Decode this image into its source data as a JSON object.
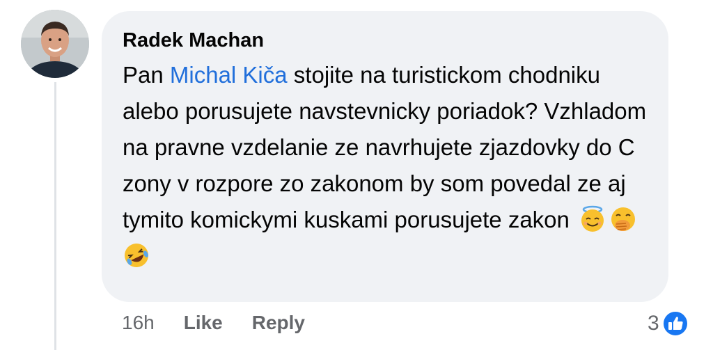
{
  "comment": {
    "author": "Radek Machan",
    "text_before": "Pan ",
    "mention": "Michal Kiča",
    "text_after": " stojite na turistickom chodniku alebo porusujete navstevnicky poriadok? Vzhladom na pravne vzdelanie ze navrhujete zjazdovky do C zony v rozpore zo zakonom by som povedal ze aj tymito komickymi kuskami porusujete zakon ",
    "emojis": [
      "smiling-face-with-halo-icon",
      "face-with-hand-over-mouth-icon",
      "rolling-on-floor-laughing-icon"
    ]
  },
  "actions": {
    "time": "16h",
    "like_label": "Like",
    "reply_label": "Reply"
  },
  "reactions": {
    "count": "3",
    "icon": "like-thumb-icon",
    "color": "#1877f2"
  },
  "colors": {
    "bubble": "#f0f2f5",
    "mention": "#216fdb",
    "secondary_text": "#65676b"
  }
}
